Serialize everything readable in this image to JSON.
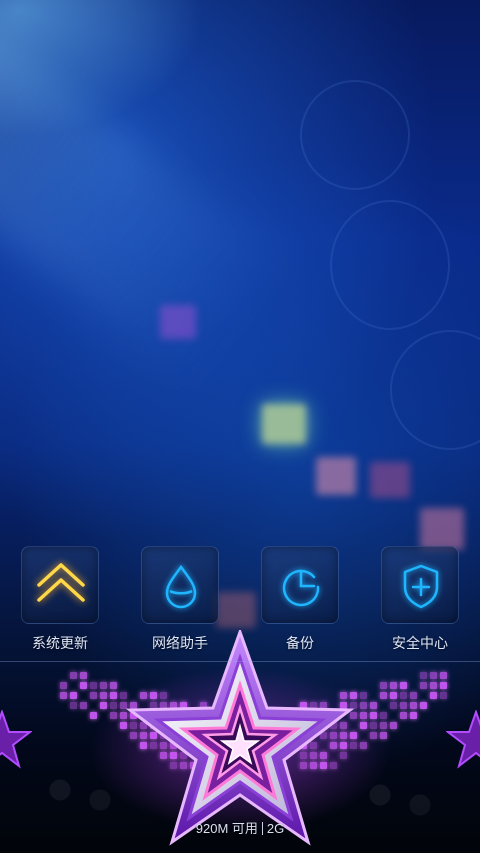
{
  "apps": [
    {
      "label": "系统更新",
      "icon": "double-chevron-up-icon",
      "icon_color": "#ffc43a"
    },
    {
      "label": "网络助手",
      "icon": "water-drop-icon",
      "icon_color": "#1fb6ff"
    },
    {
      "label": "备份",
      "icon": "backup-circle-icon",
      "icon_color": "#1fb6ff"
    },
    {
      "label": "安全中心",
      "icon": "shield-plus-icon",
      "icon_color": "#1fb6ff"
    }
  ],
  "memory": {
    "available": "920M 可用",
    "total": "2G"
  },
  "colors": {
    "accent_neon_blue": "#1fb6ff",
    "accent_neon_gold": "#ffc43a",
    "stage_purple": "#d35cff"
  }
}
